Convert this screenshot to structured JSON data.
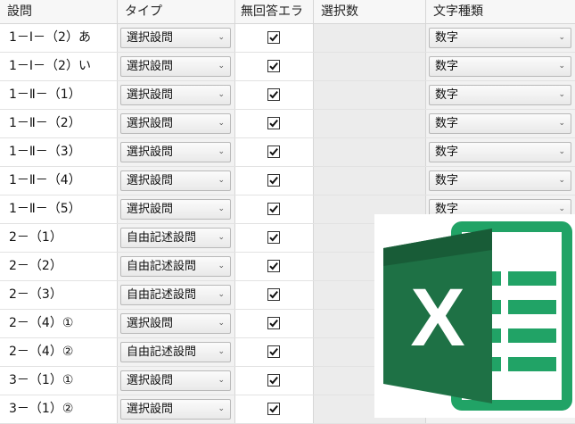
{
  "headers": [
    "設問",
    "タイプ",
    "無回答エラー",
    "選択数",
    "文字種類"
  ],
  "rows": [
    {
      "q": "1－Ⅰ－（2）あ",
      "type": "選択設問",
      "checked": true,
      "count": "",
      "char": "数字"
    },
    {
      "q": "1－Ⅰ－（2）い",
      "type": "選択設問",
      "checked": true,
      "count": "",
      "char": "数字"
    },
    {
      "q": "1－Ⅱ－（1）",
      "type": "選択設問",
      "checked": true,
      "count": "",
      "char": "数字"
    },
    {
      "q": "1－Ⅱ－（2）",
      "type": "選択設問",
      "checked": true,
      "count": "",
      "char": "数字"
    },
    {
      "q": "1－Ⅱ－（3）",
      "type": "選択設問",
      "checked": true,
      "count": "",
      "char": "数字"
    },
    {
      "q": "1－Ⅱ－（4）",
      "type": "選択設問",
      "checked": true,
      "count": "",
      "char": "数字"
    },
    {
      "q": "1－Ⅱ－（5）",
      "type": "選択設問",
      "checked": true,
      "count": "",
      "char": "数字"
    },
    {
      "q": "2－（1）",
      "type": "自由記述設問",
      "checked": true,
      "count": "",
      "char": ""
    },
    {
      "q": "2－（2）",
      "type": "自由記述設問",
      "checked": true,
      "count": "",
      "char": ""
    },
    {
      "q": "2－（3）",
      "type": "自由記述設問",
      "checked": true,
      "count": "",
      "char": ""
    },
    {
      "q": "2－（4）①",
      "type": "選択設問",
      "checked": true,
      "count": "",
      "char": ""
    },
    {
      "q": "2－（4）②",
      "type": "自由記述設問",
      "checked": true,
      "count": "",
      "char": ""
    },
    {
      "q": "3－（1）①",
      "type": "選択設問",
      "checked": true,
      "count": "",
      "char": ""
    },
    {
      "q": "3－（1）②",
      "type": "選択設問",
      "checked": true,
      "count": "",
      "char": ""
    }
  ],
  "logo": {
    "icon": "excel-logo-icon",
    "colors": {
      "dark": "#185c37",
      "mid": "#21a366",
      "light": "#33c481",
      "ink": "#ffffff"
    }
  }
}
